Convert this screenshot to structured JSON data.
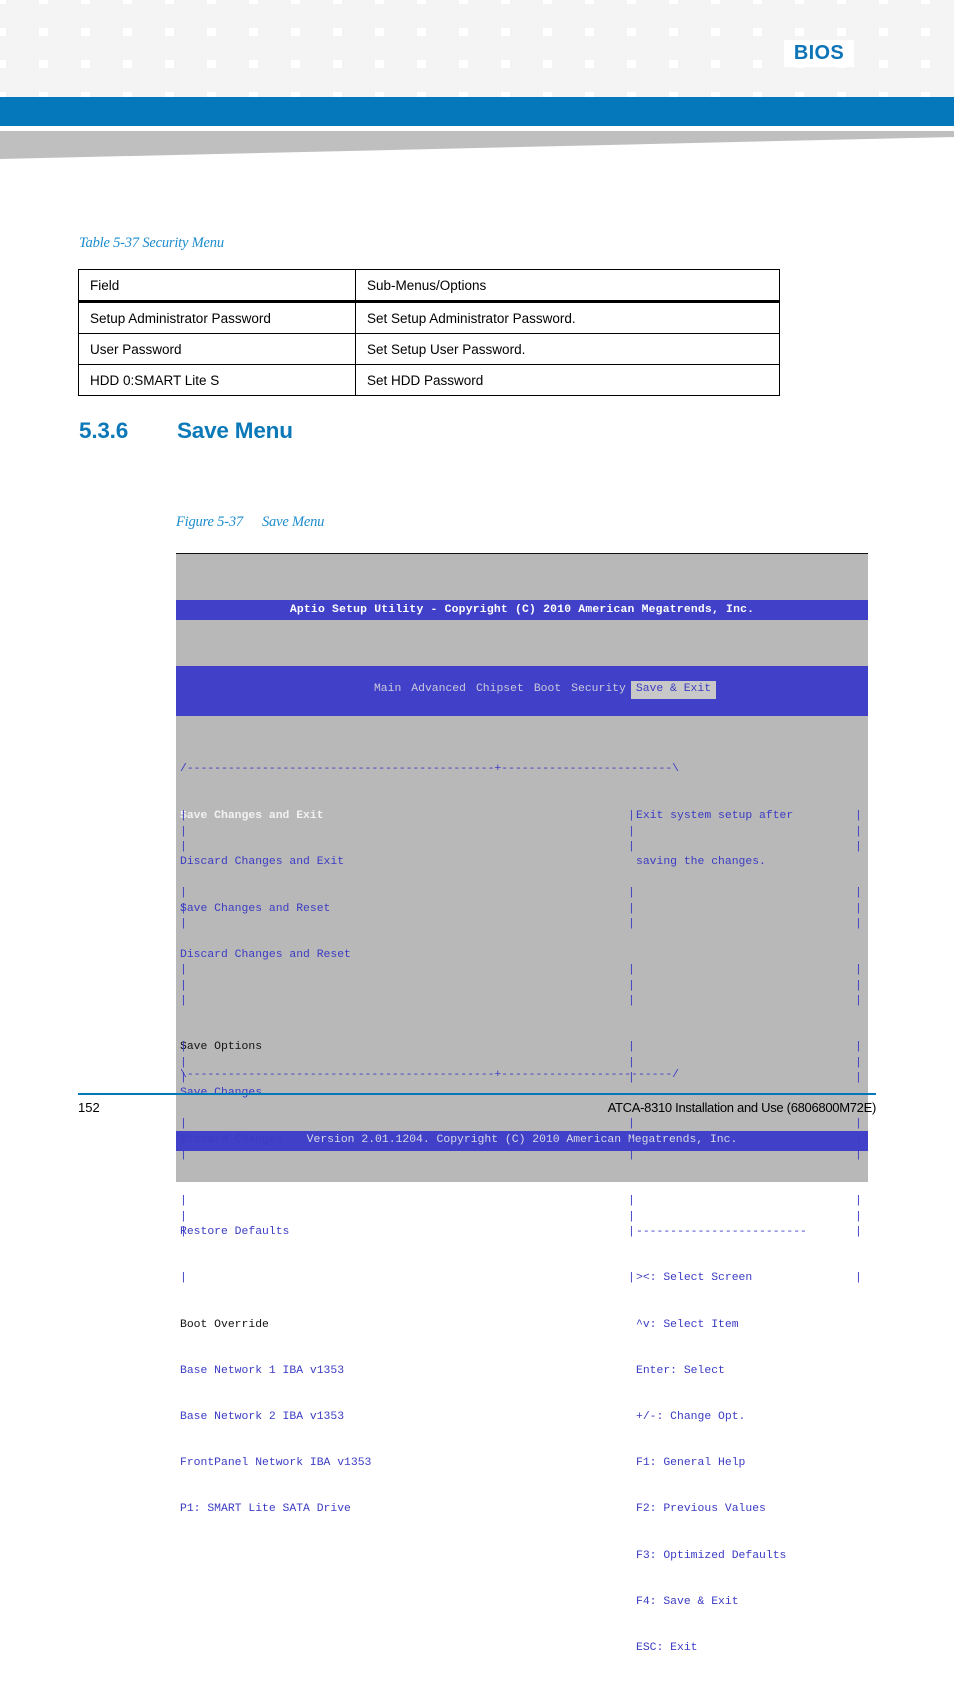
{
  "header": {
    "section_label": "BIOS"
  },
  "table": {
    "caption": "Table 5-37 Security Menu",
    "columns": [
      "Field",
      "Sub-Menus/Options"
    ],
    "rows": [
      [
        "Setup Administrator Password",
        "Set Setup Administrator Password."
      ],
      [
        "User Password",
        "Set Setup User Password."
      ],
      [
        "HDD 0:SMART Lite S",
        "Set HDD Password"
      ]
    ]
  },
  "section": {
    "number": "5.3.6",
    "title": "Save Menu"
  },
  "figure": {
    "number": "Figure 5-37",
    "title": "Save Menu"
  },
  "bios": {
    "title": "Aptio Setup Utility - Copyright (C) 2010 American Megatrends, Inc.",
    "menu_items": [
      {
        "label": "Main",
        "active": false
      },
      {
        "label": "Advanced",
        "active": false
      },
      {
        "label": "Chipset",
        "active": false
      },
      {
        "label": "Boot",
        "active": false
      },
      {
        "label": "Security",
        "active": false
      },
      {
        "label": "Save & Exit",
        "active": true
      }
    ],
    "frame_top": "/---------------------------------------------+",
    "frame_bottom": "\\---------------------------------------------+",
    "left_items": [
      {
        "text": "Save Changes and Exit",
        "style": "selected"
      },
      {
        "text": "Discard Changes and Exit",
        "style": "normal"
      },
      {
        "text": "Save Changes and Reset",
        "style": "normal"
      },
      {
        "text": "Discard Changes and Reset",
        "style": "normal"
      },
      {
        "text": "",
        "style": "blank"
      },
      {
        "text": "Save Options",
        "style": "header"
      },
      {
        "text": "Save Changes",
        "style": "normal"
      },
      {
        "text": "Discard Changes",
        "style": "normal"
      },
      {
        "text": "",
        "style": "blank"
      },
      {
        "text": "Restore Defaults",
        "style": "normal"
      },
      {
        "text": "",
        "style": "blank"
      },
      {
        "text": "Boot Override",
        "style": "header"
      },
      {
        "text": "Base Network 1 IBA v1353",
        "style": "normal"
      },
      {
        "text": "Base Network 2 IBA v1353",
        "style": "normal"
      },
      {
        "text": "FrontPanel Network IBA v1353",
        "style": "normal"
      },
      {
        "text": "P1: SMART Lite SATA Drive",
        "style": "normal"
      },
      {
        "text": "",
        "style": "blank"
      },
      {
        "text": "",
        "style": "blank"
      },
      {
        "text": "",
        "style": "blank"
      },
      {
        "text": "",
        "style": "blank"
      }
    ],
    "help_text": [
      "Exit system setup after",
      "saving the changes."
    ],
    "key_bindings": [
      "><: Select Screen",
      "^v: Select Item",
      "Enter: Select",
      "+/-: Change Opt.",
      "F1: General Help",
      "F2: Previous Values",
      "F3: Optimized Defaults",
      "F4: Save & Exit",
      "ESC: Exit"
    ],
    "status": "Version 2.01.1204. Copyright (C) 2010 American Megatrends, Inc."
  },
  "footer": {
    "page_number": "152",
    "document": "ATCA-8310 Installation and Use (6806800M72E)"
  }
}
